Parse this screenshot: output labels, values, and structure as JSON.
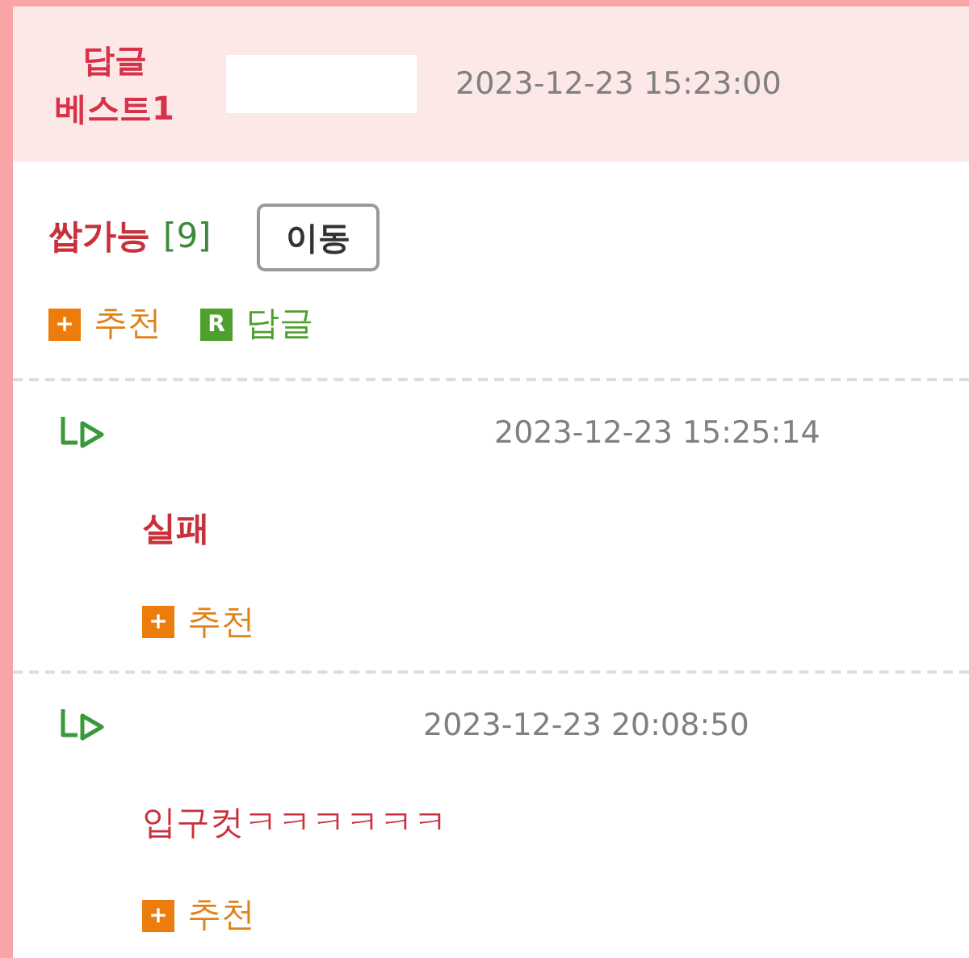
{
  "best_header": {
    "badge_lines": [
      "답글",
      "베스트1"
    ],
    "time": "2023-12-23 15:23:00"
  },
  "post": {
    "comment": "쌉가능",
    "count": "[9]",
    "move_button": "이동",
    "actions": [
      {
        "kind": "recommend",
        "icon": "+",
        "label": "추천"
      },
      {
        "kind": "reply",
        "icon": "R",
        "label": "답글"
      }
    ]
  },
  "replies": [
    {
      "time": "2023-12-23 15:25:14",
      "comment": "실패",
      "actions": [
        {
          "kind": "recommend",
          "icon": "+",
          "label": "추천"
        }
      ]
    },
    {
      "time": "2023-12-23 20:08:50",
      "comment": "입구컷ㅋㅋㅋㅋㅋㅋ",
      "actions": [
        {
          "kind": "recommend",
          "icon": "+",
          "label": "추천"
        }
      ]
    }
  ]
}
